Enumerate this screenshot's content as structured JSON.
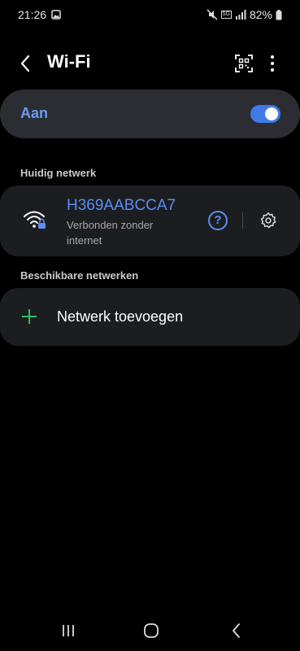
{
  "status": {
    "time": "21:26",
    "battery_percent": "82%",
    "network_badge": "5G"
  },
  "header": {
    "title": "Wi-Fi"
  },
  "toggle": {
    "label": "Aan",
    "on": true
  },
  "sections": {
    "current": "Huidig netwerk",
    "available": "Beschikbare netwerken"
  },
  "current_network": {
    "ssid": "H369AABCCA7",
    "status": "Verbonden zonder internet",
    "help_glyph": "?"
  },
  "add_network": {
    "label": "Netwerk toevoegen"
  },
  "colors": {
    "accent": "#5b8ef0",
    "switch": "#3e7be8",
    "card": "#1c1d21",
    "toggle_card": "#2b2d33",
    "plus": "#2fbf5f"
  },
  "icons": {
    "status_left": [
      "image-icon"
    ],
    "status_right": [
      "mute-icon",
      "signal-icon",
      "battery-icon"
    ],
    "header": [
      "back-icon",
      "qr-code-icon",
      "more-icon"
    ],
    "network": [
      "wifi-lock-icon",
      "help-icon",
      "settings-icon"
    ],
    "nav": [
      "recents-icon",
      "home-icon",
      "back-nav-icon"
    ]
  }
}
